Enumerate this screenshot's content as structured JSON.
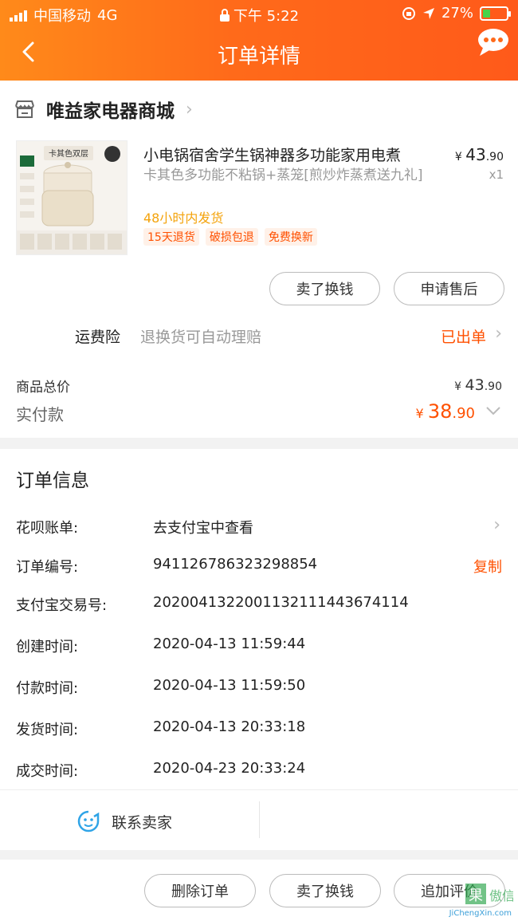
{
  "status_bar": {
    "carrier": "中国移动",
    "network": "4G",
    "time": "下午 5:22",
    "battery": "27%"
  },
  "nav": {
    "title": "订单详情"
  },
  "shop": {
    "name": "唯益家电器商城"
  },
  "product": {
    "thumb_caption": "卡其色双层",
    "title": "小电锅宿舍学生锅神器多功能家用电煮",
    "sku": "卡其色多功能不粘锅+蒸笼[煎炒炸蒸煮送九礼]",
    "shipping": "48小时内发货",
    "tags": [
      "15天退货",
      "破损包退",
      "免费换新"
    ],
    "price_symbol": "¥",
    "price_int": "43",
    "price_dec": ".90",
    "qty": "x1"
  },
  "item_buttons": {
    "sell": "卖了换钱",
    "after_sales": "申请售后"
  },
  "insurance": {
    "label": "运费险",
    "desc": "退换货可自动理赔",
    "status": "已出单"
  },
  "summary": {
    "goods_total_label": "商品总价",
    "goods_total_symbol": "¥",
    "goods_total_int": "43",
    "goods_total_dec": ".90",
    "paid_label": "实付款",
    "paid_symbol": "¥",
    "paid_int": "38",
    "paid_dec": ".90"
  },
  "order_info": {
    "title": "订单信息",
    "rows": [
      {
        "key": "花呗账单:",
        "value": "去支付宝中查看"
      },
      {
        "key": "订单编号:",
        "value": "941126786323298854",
        "action": "复制"
      },
      {
        "key": "支付宝交易号:",
        "value": "2020041322001132111443674114"
      },
      {
        "key": "创建时间:",
        "value": "2020-04-13 11:59:44"
      },
      {
        "key": "付款时间:",
        "value": "2020-04-13 11:59:50"
      },
      {
        "key": "发货时间:",
        "value": "2020-04-13 20:33:18"
      },
      {
        "key": "成交时间:",
        "value": "2020-04-23 20:33:24"
      }
    ]
  },
  "contact": {
    "label": "联系卖家"
  },
  "bottom_buttons": {
    "delete": "删除订单",
    "sell": "卖了换钱",
    "review": "追加评价"
  },
  "watermark": {
    "text": "JiChengXin.com"
  },
  "colors": {
    "accent": "#ff5000",
    "header_start": "#ff8a1a",
    "header_end": "#ff5a1a",
    "ship": "#f4a30b"
  }
}
